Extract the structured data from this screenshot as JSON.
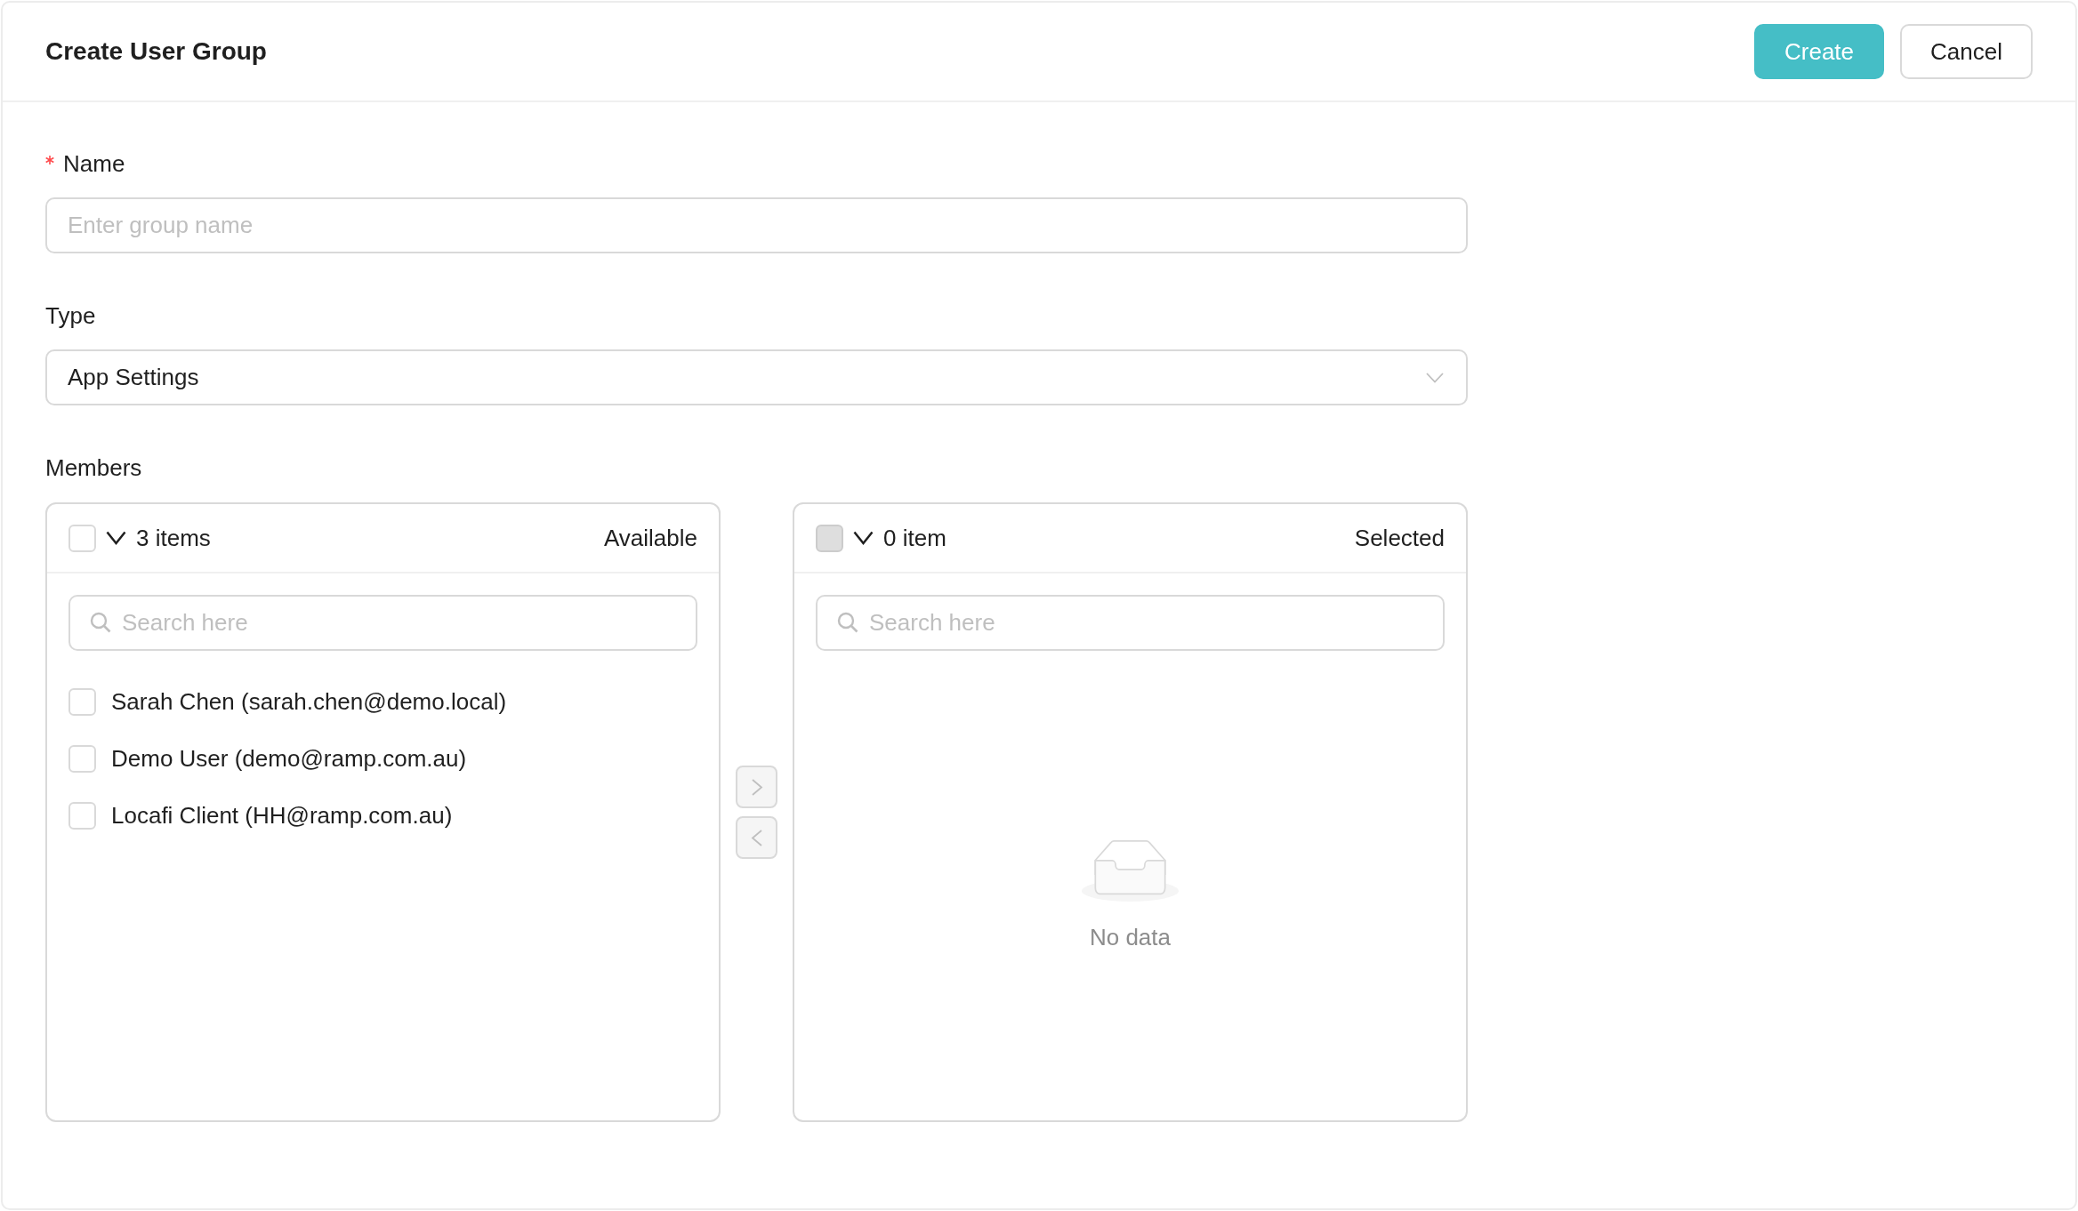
{
  "header": {
    "title": "Create User Group",
    "buttons": [
      {
        "label": "Create",
        "kind": "primary"
      },
      {
        "label": "Cancel",
        "kind": "default"
      }
    ]
  },
  "fields": [
    {
      "kind": "input",
      "label": "Name",
      "required": true,
      "placeholder": "Enter group name"
    },
    {
      "kind": "select",
      "label": "Type",
      "required": false,
      "value": "App Settings"
    }
  ],
  "members": {
    "label": "Members",
    "lists": [
      {
        "count": "3 items",
        "title": "Available",
        "select_all": {
          "checked": false,
          "disabled": false
        },
        "search": {
          "placeholder": "Search here"
        },
        "items": [
          {
            "label": "Sarah Chen (sarah.chen@demo.local)",
            "checked": false
          },
          {
            "label": "Demo User (demo@ramp.com.au)",
            "checked": false
          },
          {
            "label": "Locafi Client (HH@ramp.com.au)",
            "checked": false
          }
        ]
      },
      {
        "count": "0 item",
        "title": "Selected",
        "select_all": {
          "checked": false,
          "disabled": true
        },
        "search": {
          "placeholder": "Search here"
        },
        "empty_text": "No data"
      }
    ],
    "move_buttons": [
      {
        "kind": "right",
        "disabled": true
      },
      {
        "kind": "left",
        "disabled": true
      }
    ]
  }
}
